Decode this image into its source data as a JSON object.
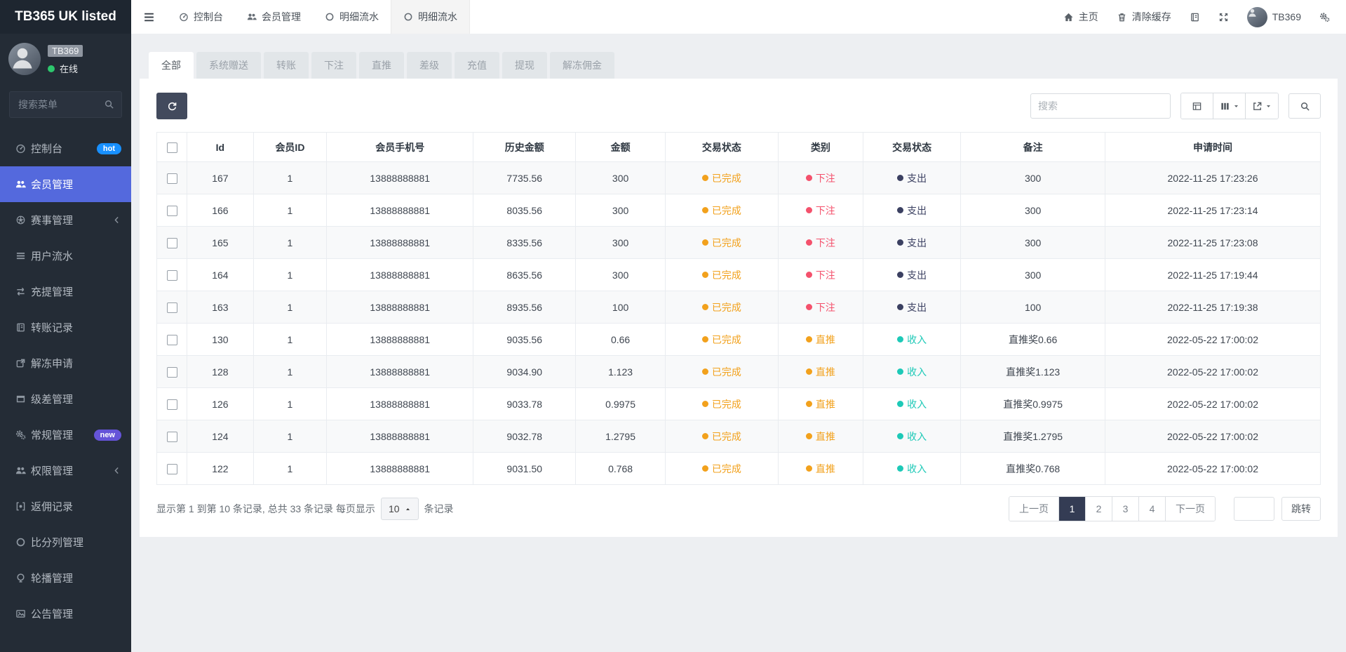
{
  "brand": "TB365 UK listed",
  "user": {
    "name": "TB369",
    "status": "在线"
  },
  "colors": {
    "sidebar_active": "#5469dd",
    "online_green": "#2dc76d",
    "badges": {
      "hot": "#1890ff",
      "new": "#6554d8"
    },
    "status": {
      "已完成": "#f2a11c",
      "下注": "#f4516c",
      "直推": "#f2a11c",
      "支出": "#3b4061",
      "收入": "#1dc9b7"
    },
    "pagination_active": "#343c54"
  },
  "sidebar": {
    "search_placeholder": "搜索菜单",
    "items": [
      {
        "name": "dashboard",
        "icon": "gauge-icon",
        "label": "控制台",
        "badge": "hot",
        "active": false,
        "chevron": false
      },
      {
        "name": "members",
        "icon": "users-icon",
        "label": "会员管理",
        "badge": "",
        "active": true,
        "chevron": false
      },
      {
        "name": "matches",
        "icon": "ball-icon",
        "label": "赛事管理",
        "badge": "",
        "active": false,
        "chevron": true
      },
      {
        "name": "user-flow",
        "icon": "list-icon",
        "label": "用户流水",
        "badge": "",
        "active": false,
        "chevron": false
      },
      {
        "name": "deposit-withdraw",
        "icon": "exchange-icon",
        "label": "充提管理",
        "badge": "",
        "active": false,
        "chevron": false
      },
      {
        "name": "transfer-records",
        "icon": "book-icon",
        "label": "转账记录",
        "badge": "",
        "active": false,
        "chevron": false
      },
      {
        "name": "unfreeze-requests",
        "icon": "unfreeze-icon",
        "label": "解冻申请",
        "badge": "",
        "active": false,
        "chevron": false
      },
      {
        "name": "level-diff",
        "icon": "window-icon",
        "label": "级差管理",
        "badge": "",
        "active": false,
        "chevron": false
      },
      {
        "name": "general",
        "icon": "gears-icon",
        "label": "常规管理",
        "badge": "new",
        "active": false,
        "chevron": false
      },
      {
        "name": "permissions",
        "icon": "users-icon",
        "label": "权限管理",
        "badge": "",
        "active": false,
        "chevron": true
      },
      {
        "name": "rebate-records",
        "icon": "bracket-icon",
        "label": "返佣记录",
        "badge": "",
        "active": false,
        "chevron": false
      },
      {
        "name": "score-list",
        "icon": "circle-icon",
        "label": "比分列管理",
        "badge": "",
        "active": false,
        "chevron": false
      },
      {
        "name": "carousel",
        "icon": "carousel-icon",
        "label": "轮播管理",
        "badge": "",
        "active": false,
        "chevron": false
      },
      {
        "name": "announcements",
        "icon": "image-icon",
        "label": "公告管理",
        "badge": "",
        "active": false,
        "chevron": false
      }
    ]
  },
  "navbar": {
    "tabs": [
      {
        "name": "dashboard",
        "icon": "gauge-icon",
        "label": "控制台",
        "active": false
      },
      {
        "name": "members",
        "icon": "users-icon",
        "label": "会员管理",
        "active": false
      },
      {
        "name": "flow-detail-1",
        "icon": "circle-icon",
        "label": "明细流水",
        "active": false
      },
      {
        "name": "flow-detail-2",
        "icon": "circle-icon",
        "label": "明细流水",
        "active": true
      }
    ],
    "home": "主页",
    "clear_cache": "清除缓存",
    "username": "TB369"
  },
  "filter_tabs": [
    {
      "name": "all",
      "label": "全部",
      "active": true
    },
    {
      "name": "system-gift",
      "label": "系统赠送",
      "active": false
    },
    {
      "name": "transfer",
      "label": "转账",
      "active": false
    },
    {
      "name": "bet",
      "label": "下注",
      "active": false
    },
    {
      "name": "direct-referral",
      "label": "直推",
      "active": false
    },
    {
      "name": "level-diff",
      "label": "差级",
      "active": false
    },
    {
      "name": "deposit",
      "label": "充值",
      "active": false
    },
    {
      "name": "withdraw",
      "label": "提现",
      "active": false
    },
    {
      "name": "unfreeze-commission",
      "label": "解冻佣金",
      "active": false
    }
  ],
  "toolbar": {
    "search_placeholder": "搜索"
  },
  "table": {
    "headers": [
      "Id",
      "会员ID",
      "会员手机号",
      "历史金额",
      "金额",
      "交易状态",
      "类别",
      "交易状态",
      "备注",
      "申请时间"
    ],
    "rows": [
      {
        "id": "167",
        "member_id": "1",
        "phone": "13888888881",
        "history_amount": "7735.56",
        "amount": "300",
        "trade_status": "已完成",
        "category": "下注",
        "direction": "支出",
        "remark": "300",
        "time": "2022-11-25 17:23:26"
      },
      {
        "id": "166",
        "member_id": "1",
        "phone": "13888888881",
        "history_amount": "8035.56",
        "amount": "300",
        "trade_status": "已完成",
        "category": "下注",
        "direction": "支出",
        "remark": "300",
        "time": "2022-11-25 17:23:14"
      },
      {
        "id": "165",
        "member_id": "1",
        "phone": "13888888881",
        "history_amount": "8335.56",
        "amount": "300",
        "trade_status": "已完成",
        "category": "下注",
        "direction": "支出",
        "remark": "300",
        "time": "2022-11-25 17:23:08"
      },
      {
        "id": "164",
        "member_id": "1",
        "phone": "13888888881",
        "history_amount": "8635.56",
        "amount": "300",
        "trade_status": "已完成",
        "category": "下注",
        "direction": "支出",
        "remark": "300",
        "time": "2022-11-25 17:19:44"
      },
      {
        "id": "163",
        "member_id": "1",
        "phone": "13888888881",
        "history_amount": "8935.56",
        "amount": "100",
        "trade_status": "已完成",
        "category": "下注",
        "direction": "支出",
        "remark": "100",
        "time": "2022-11-25 17:19:38"
      },
      {
        "id": "130",
        "member_id": "1",
        "phone": "13888888881",
        "history_amount": "9035.56",
        "amount": "0.66",
        "trade_status": "已完成",
        "category": "直推",
        "direction": "收入",
        "remark": "直推奖0.66",
        "time": "2022-05-22 17:00:02"
      },
      {
        "id": "128",
        "member_id": "1",
        "phone": "13888888881",
        "history_amount": "9034.90",
        "amount": "1.123",
        "trade_status": "已完成",
        "category": "直推",
        "direction": "收入",
        "remark": "直推奖1.123",
        "time": "2022-05-22 17:00:02"
      },
      {
        "id": "126",
        "member_id": "1",
        "phone": "13888888881",
        "history_amount": "9033.78",
        "amount": "0.9975",
        "trade_status": "已完成",
        "category": "直推",
        "direction": "收入",
        "remark": "直推奖0.9975",
        "time": "2022-05-22 17:00:02"
      },
      {
        "id": "124",
        "member_id": "1",
        "phone": "13888888881",
        "history_amount": "9032.78",
        "amount": "1.2795",
        "trade_status": "已完成",
        "category": "直推",
        "direction": "收入",
        "remark": "直推奖1.2795",
        "time": "2022-05-22 17:00:02"
      },
      {
        "id": "122",
        "member_id": "1",
        "phone": "13888888881",
        "history_amount": "9031.50",
        "amount": "0.768",
        "trade_status": "已完成",
        "category": "直推",
        "direction": "收入",
        "remark": "直推奖0.768",
        "time": "2022-05-22 17:00:02"
      }
    ]
  },
  "footer": {
    "summary_prefix": "显示第 1 到第 10 条记录, 总共 33 条记录 每页显示",
    "page_size": "10",
    "summary_suffix": "条记录",
    "pagination": {
      "prev": "上一页",
      "pages": [
        "1",
        "2",
        "3",
        "4"
      ],
      "active": "1",
      "next": "下一页",
      "jump": "跳转"
    }
  }
}
